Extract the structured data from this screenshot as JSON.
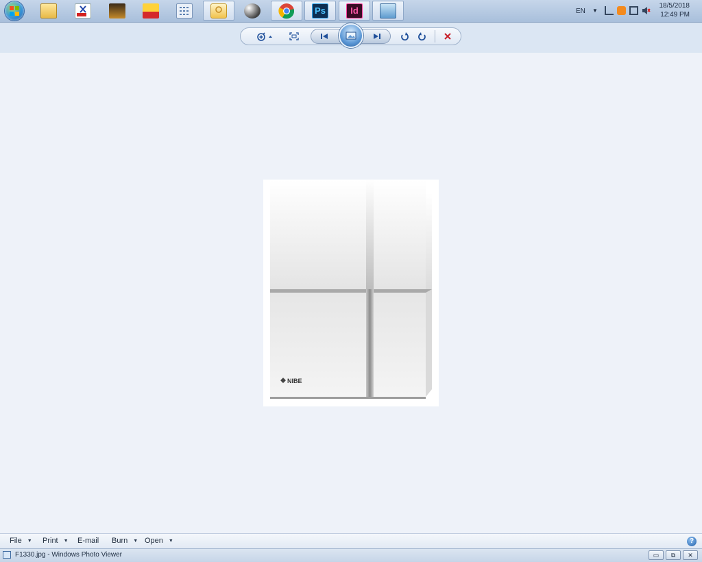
{
  "taskbar": {
    "apps": [
      {
        "name": "windows-explorer",
        "active": false
      },
      {
        "name": "pdf-tool",
        "active": false
      },
      {
        "name": "media-app",
        "active": false
      },
      {
        "name": "calendar-app",
        "active": false
      },
      {
        "name": "calculator-app",
        "active": false
      },
      {
        "name": "photo-viewer",
        "active": true
      },
      {
        "name": "paint-app",
        "active": false
      },
      {
        "name": "chrome",
        "active": false
      },
      {
        "name": "photoshop",
        "active": false
      },
      {
        "name": "indesign",
        "active": false
      },
      {
        "name": "image-app",
        "active": false
      }
    ],
    "tray": {
      "language": "EN",
      "time": "12:49 PM",
      "date": "18/5/2018"
    }
  },
  "toolbar": {
    "buttons": [
      "zoom",
      "fit-to-window",
      "previous",
      "slideshow",
      "next",
      "rotate-counterclockwise",
      "rotate-clockwise",
      "delete"
    ]
  },
  "photo": {
    "brand": "NIBE"
  },
  "menu": {
    "file": "File",
    "print": "Print",
    "email": "E-mail",
    "burn": "Burn",
    "open": "Open",
    "help": "?"
  },
  "window": {
    "title": "F1330.jpg - Windows Photo Viewer",
    "minimize": "▭",
    "restore": "⧉",
    "close": "✕"
  },
  "colors": {
    "taskbar": "#a8bfdb",
    "background": "#eef2f9",
    "delete": "#c8202a",
    "nav": "#1f4f9a"
  }
}
